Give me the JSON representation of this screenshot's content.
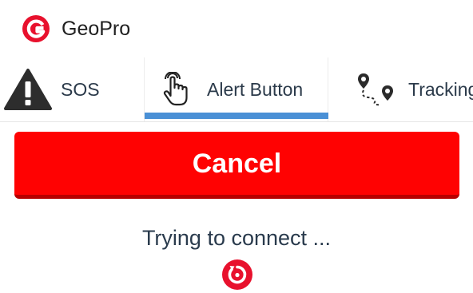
{
  "app": {
    "title": "GeoPro",
    "logo_icon": "geopro-logo-icon",
    "brand_color": "#e8112d"
  },
  "tabs": [
    {
      "label": "SOS",
      "icon": "warning-triangle-icon",
      "active": false
    },
    {
      "label": "Alert Button",
      "icon": "tap-hand-icon",
      "active": true
    },
    {
      "label": "Tracking",
      "icon": "route-pins-icon",
      "active": false
    }
  ],
  "active_tab_color": "#4a90d6",
  "cancel_button": {
    "label": "Cancel",
    "color": "#ff0202"
  },
  "status": {
    "text": "Trying to connect ...",
    "icon": "refresh-spinner-icon"
  }
}
